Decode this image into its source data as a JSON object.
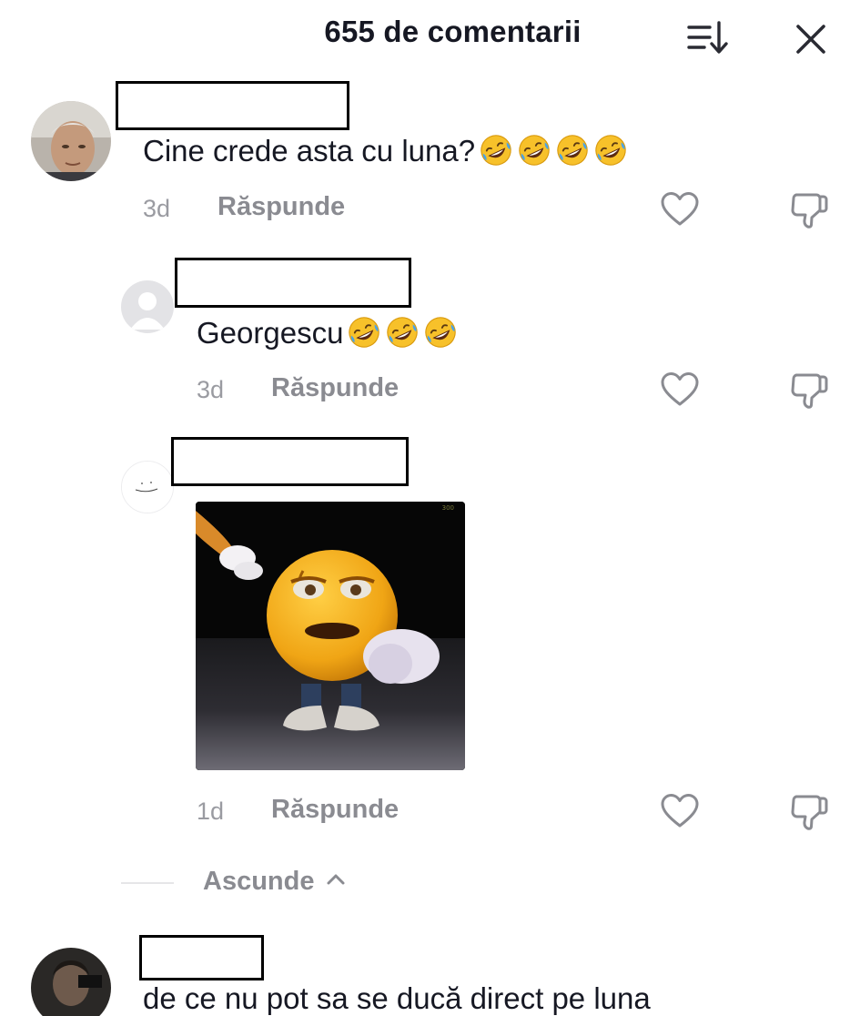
{
  "header": {
    "title": "655 de comentarii"
  },
  "comments": [
    {
      "text": "Cine crede asta cu luna?",
      "emoji_count": 4,
      "emoji": "rolling-on-floor-laughing",
      "time": "3d",
      "reply_label": "Răspunde"
    },
    {
      "text": "Georgescu",
      "emoji_count": 3,
      "emoji": "rolling-on-floor-laughing",
      "time": "3d",
      "reply_label": "Răspunde"
    },
    {
      "text": "",
      "attachment": "emoji-character-dancing-image",
      "time": "1d",
      "reply_label": "Răspunde"
    },
    {
      "text": "de ce nu pot sa se ducă direct pe luna"
    }
  ],
  "hide_replies": {
    "label": "Ascunde"
  },
  "icons": {
    "sort": "sort-icon",
    "close": "close-icon",
    "like": "heart-outline-icon",
    "dislike": "thumbs-down-outline-icon",
    "hide": "chevron-up-icon"
  },
  "colors": {
    "text_primary": "#161823",
    "text_secondary": "#8a8b91",
    "timestamp": "#9a9ba1"
  }
}
